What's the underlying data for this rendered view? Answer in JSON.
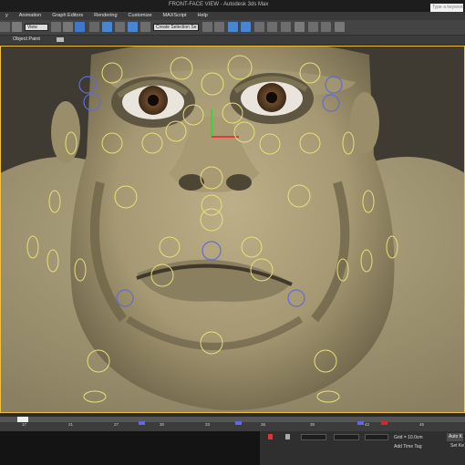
{
  "titlebar": {
    "title": "FRONT-FACE VIEW - Autodesk 3ds Max",
    "search_placeholder": "Type a keyword or"
  },
  "menus": [
    "y",
    "Animation",
    "Graph Editors",
    "Rendering",
    "Customize",
    "MAXScript",
    "Help"
  ],
  "toolbar": {
    "filter_value": "View",
    "selection_set_value": "Create Selection Se"
  },
  "ribbon": {
    "object_paint": "Object Paint"
  },
  "timeline": {
    "ticks": [
      "17",
      "21",
      "27",
      "30",
      "33",
      "36",
      "38",
      "42",
      "45"
    ],
    "current_frame_marker": ""
  },
  "statusbar": {
    "grid": "Grid = 10.0cm",
    "add_time_tag": "Add Time Tag",
    "auto_key": "Auto K",
    "set_key": "Set Ke"
  },
  "colors": {
    "viewport_bg": "#4a463c",
    "skin": "#b3a77f",
    "control_yellow": "#e7df79",
    "control_blue": "#5f6bd8",
    "active_border": "#f0c040"
  }
}
